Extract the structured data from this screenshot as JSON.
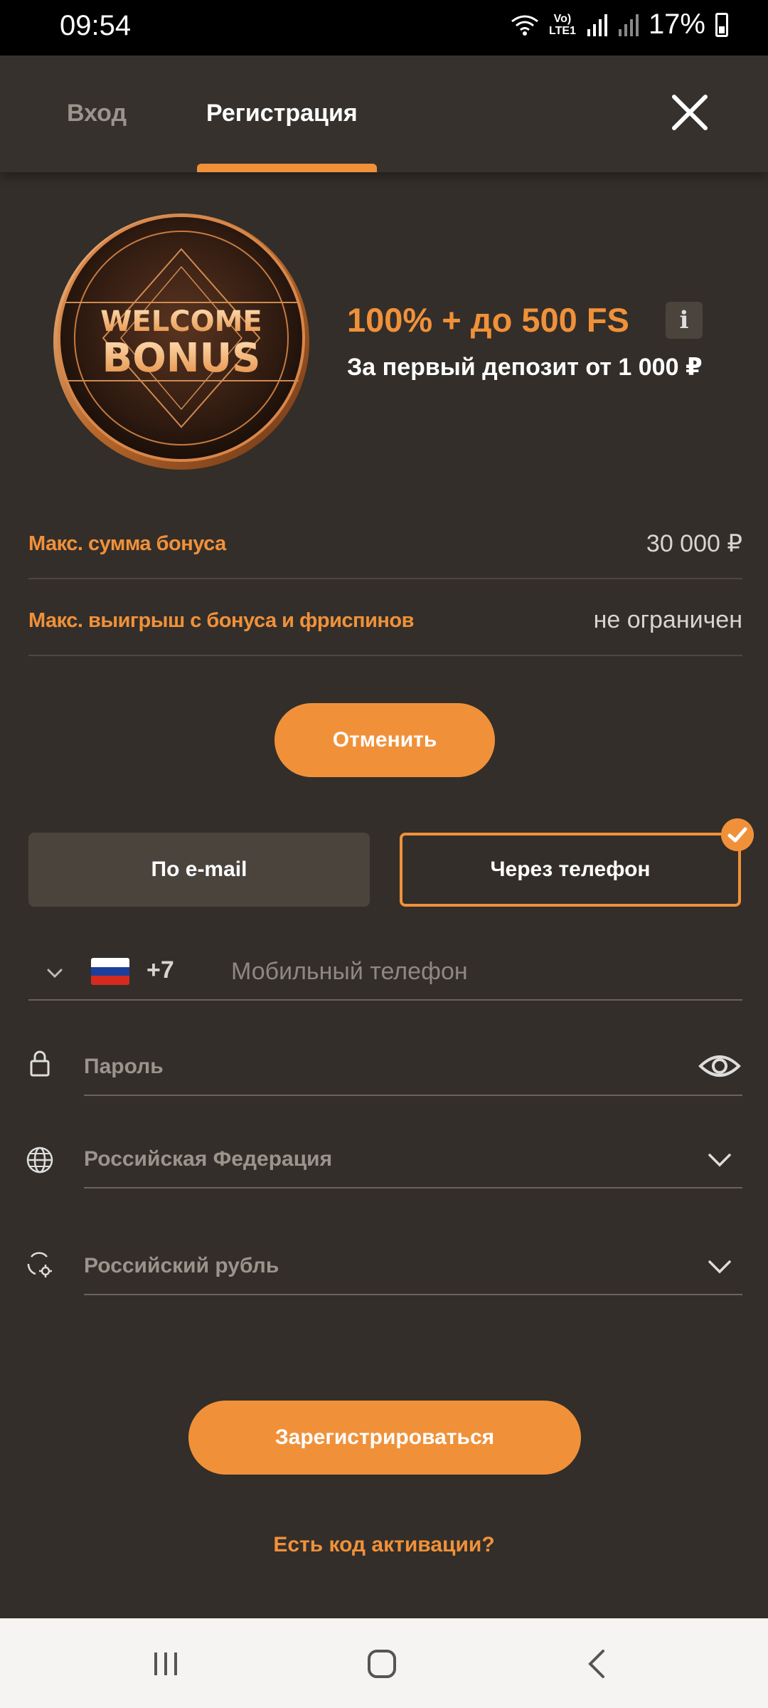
{
  "status_bar": {
    "time": "09:54",
    "network_top": "Vo)",
    "network_bottom": "LTE1",
    "battery": "17%"
  },
  "tabs": {
    "login": "Вход",
    "register": "Регистрация"
  },
  "coin": {
    "line1": "WELCOME",
    "line2": "BONUS"
  },
  "bonus": {
    "title": "100% + до 500 FS",
    "info": "i",
    "subtitle": "За первый депозит от 1 000 ₽"
  },
  "details": [
    {
      "label": "Макс. сумма бонуса",
      "value": "30 000 ₽"
    },
    {
      "label": "Макс. выигрыш с бонуса и фриспинов",
      "value": "не ограничен"
    }
  ],
  "cancel_button": "Отменить",
  "methods": {
    "email": "По e-mail",
    "phone": "Через телефон"
  },
  "phone": {
    "code": "+7",
    "placeholder": "Мобильный телефон"
  },
  "password": {
    "placeholder": "Пароль"
  },
  "country": {
    "value": "Российская Федерация"
  },
  "currency": {
    "value": "Российский рубль"
  },
  "register_button": "Зарегистрироваться",
  "activation_link": "Есть код активации?",
  "colors": {
    "accent": "#f0913a",
    "background": "#332e29",
    "muted": "#9b948c"
  }
}
